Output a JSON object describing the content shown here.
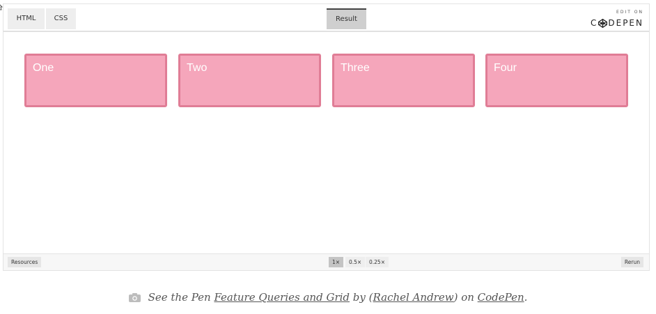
{
  "toolbar": {
    "tabs": [
      {
        "label": "HTML",
        "active": false
      },
      {
        "label": "CSS",
        "active": false
      },
      {
        "label": "Result",
        "active": true
      }
    ],
    "brand_top": "EDIT ON",
    "brand_name_left": "C",
    "brand_name_right": "DEPEN"
  },
  "result": {
    "boxes": [
      {
        "label": "One"
      },
      {
        "label": "Two"
      },
      {
        "label": "Three"
      },
      {
        "label": "Four"
      }
    ],
    "box_color": "#f5a6bb",
    "box_border_color": "#e07d96"
  },
  "bottombar": {
    "resources_label": "Resources",
    "zoom_options": [
      {
        "label": "1×",
        "active": true
      },
      {
        "label": "0.5×",
        "active": false
      },
      {
        "label": "0.25×",
        "active": false
      }
    ],
    "rerun_label": "Rerun"
  },
  "caption": {
    "icon": "camera-icon",
    "prefix": "See the Pen ",
    "pen_title": "Feature Queries and Grid",
    "by": " by (",
    "author": "Rachel Andrew",
    "on": ") on ",
    "site": "CodePen",
    "suffix": "."
  }
}
